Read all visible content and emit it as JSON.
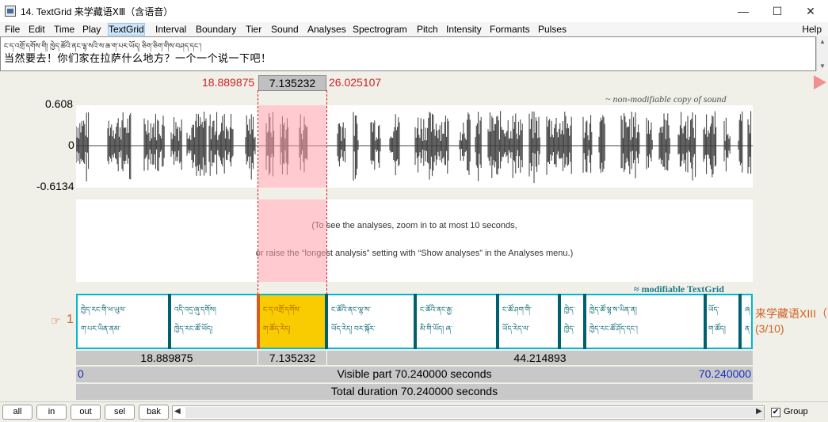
{
  "window": {
    "title": "14. TextGrid 来学藏语ⅩⅢ（含语音）",
    "minimize": "—",
    "maximize": "☐",
    "close": "✕"
  },
  "menu": {
    "items": [
      "File",
      "Edit",
      "Time",
      "Play",
      "TextGrid",
      "Interval",
      "Boundary",
      "Tier",
      "Sound",
      "Analyses",
      "Spectrogram",
      "Pitch",
      "Intensity",
      "Formants",
      "Pulses"
    ],
    "active": "TextGrid",
    "help": "Help"
  },
  "text": {
    "tibetan": "ང་ད་འགྲོ་དགོས་གི། ཁྱེད་ཚོའི་ནང་ལྷ་སའི་ས་ཆ་ག་པར་ཡོད། ཅིག་ཅིག་གིས་བཤད་དང་།",
    "chinese": "当然要去！你们家在拉萨什么地方？一个一个说一下吧！"
  },
  "selection": {
    "start": "18.889875",
    "duration": "7.135232",
    "end": "26.025107"
  },
  "sound": {
    "label": "~ non-modifiable copy of sound",
    "ymax": "0.608",
    "yzero": "0",
    "ymin": "-0.6134"
  },
  "analysis": {
    "message1": "(To see the analyses, zoom in to at most 10 seconds,",
    "message2": "or raise the “longest analysis” setting with “Show analyses” in the Analyses menu.)"
  },
  "textgrid": {
    "label": "≈ modifiable TextGrid",
    "pointer": "☞",
    "tier_number": "1",
    "tier_name": "来学藏语XIII（",
    "tier_count": "(3/10)",
    "intervals": [
      {
        "line1": "ཁྱེད་རང་གི་ཕ་ཡུལ་",
        "line2": "ག་པར་ཡིན་ནམ་"
      },
      {
        "line1": "འདི་འདྲ་ཞུ་དགོས།",
        "line2": "ཁྱེད་རང་ཚོ་ཡོད།"
      },
      {
        "line1": "ང་ད་འགྲོ་དགོས་",
        "line2": "ག་ཚོད་རེད།"
      },
      {
        "line1": "ང་ཚོའི་ནང་ལྷ་ས་",
        "line2": "ཡོད་རེད། བར་སྐོར་"
      },
      {
        "line1": "ང་ཚོའི་ནང་རྒྱ་",
        "line2": "མི་གི་ཡོད། ཞ་"
      },
      {
        "line1": "ང་ཚོ་ཤག་གི་",
        "line2": "ཡོད་རེད་ལ་"
      },
      {
        "line1": "ཁྱེད་",
        "line2": "ཁྱེད་"
      },
      {
        "line1": "ཁྱེད་ཚོ་ལྷ་ས་ཡིན་ན།",
        "line2": "ཁྱེད་རང་ཚོ་ཤོད་དང་།"
      },
      {
        "line1": "ཡོད་",
        "line2": "ག་ཚོད།"
      },
      {
        "line1": "ཞ",
        "line2": "ན"
      }
    ]
  },
  "times": {
    "left": "18.889875",
    "middle": "7.135232",
    "right": "44.214893",
    "visible_start": "0",
    "visible_part": "Visible part 70.240000 seconds",
    "visible_end": "70.240000",
    "total": "Total duration 70.240000 seconds"
  },
  "toolbar": {
    "all": "all",
    "in": "in",
    "out": "out",
    "sel": "sel",
    "bak": "bak",
    "group": "Group",
    "group_checked": "✔"
  }
}
